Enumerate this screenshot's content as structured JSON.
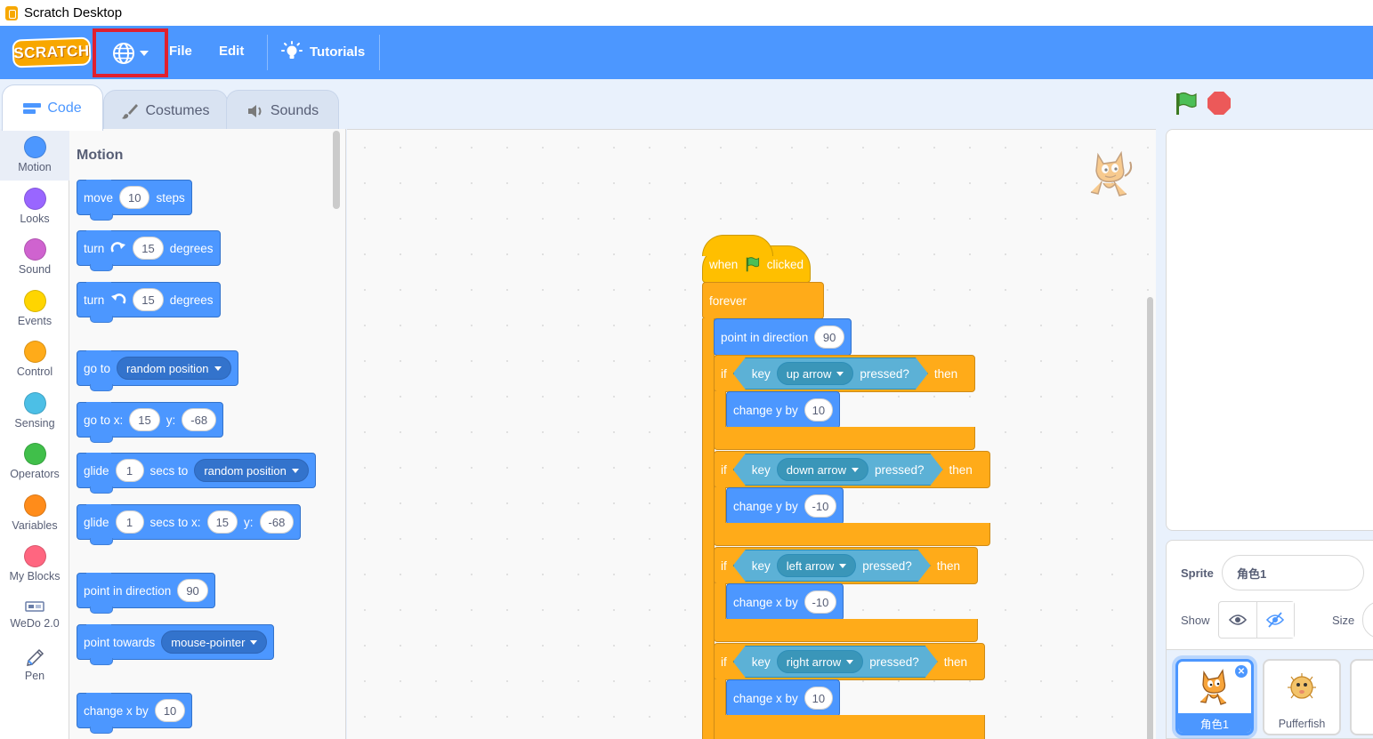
{
  "window": {
    "title": "Scratch Desktop"
  },
  "menubar": {
    "logo": "SCRATCH",
    "file": "File",
    "edit": "Edit",
    "tutorials": "Tutorials"
  },
  "tabs": [
    {
      "label": "Code",
      "icon": "code-icon"
    },
    {
      "label": "Costumes",
      "icon": "brush-icon"
    },
    {
      "label": "Sounds",
      "icon": "speaker-icon"
    }
  ],
  "categories": [
    {
      "label": "Motion",
      "color": "#4c97ff"
    },
    {
      "label": "Looks",
      "color": "#9966ff"
    },
    {
      "label": "Sound",
      "color": "#cf63cf"
    },
    {
      "label": "Events",
      "color": "#ffd500"
    },
    {
      "label": "Control",
      "color": "#ffab19"
    },
    {
      "label": "Sensing",
      "color": "#4cbfe6"
    },
    {
      "label": "Operators",
      "color": "#40bf4a"
    },
    {
      "label": "Variables",
      "color": "#ff8c1a"
    },
    {
      "label": "My Blocks",
      "color": "#ff6680"
    },
    {
      "label": "WeDo 2.0",
      "color": ""
    },
    {
      "label": "Pen",
      "color": ""
    }
  ],
  "palette": {
    "title": "Motion",
    "move": {
      "a": "move",
      "n": "10",
      "b": "steps"
    },
    "turn_right": {
      "a": "turn",
      "n": "15",
      "b": "degrees"
    },
    "turn_left": {
      "a": "turn",
      "n": "15",
      "b": "degrees"
    },
    "goto": {
      "a": "go to",
      "d": "random position"
    },
    "gotoxy": {
      "a": "go to x:",
      "x": "15",
      "b": "y:",
      "y": "-68"
    },
    "glide": {
      "a": "glide",
      "n": "1",
      "b": "secs to",
      "d": "random position"
    },
    "glidexy": {
      "a": "glide",
      "n": "1",
      "b": "secs to x:",
      "x": "15",
      "c": "y:",
      "y": "-68"
    },
    "point": {
      "a": "point in direction",
      "n": "90"
    },
    "towards": {
      "a": "point towards",
      "d": "mouse-pointer"
    },
    "changex": {
      "a": "change x by",
      "n": "10"
    }
  },
  "script": {
    "hat": {
      "a": "when",
      "b": "clicked"
    },
    "forever": "forever",
    "point": {
      "a": "point in direction",
      "n": "90"
    },
    "ifs": [
      {
        "if": "if",
        "key": "key",
        "opt": "up arrow",
        "pressed": "pressed?",
        "then": "then",
        "change": "change y by",
        "n": "10"
      },
      {
        "if": "if",
        "key": "key",
        "opt": "down arrow",
        "pressed": "pressed?",
        "then": "then",
        "change": "change y by",
        "n": "-10"
      },
      {
        "if": "if",
        "key": "key",
        "opt": "left arrow",
        "pressed": "pressed?",
        "then": "then",
        "change": "change x by",
        "n": "-10"
      },
      {
        "if": "if",
        "key": "key",
        "opt": "right arrow",
        "pressed": "pressed?",
        "then": "then",
        "change": "change x by",
        "n": "10"
      }
    ]
  },
  "sprite_info": {
    "sprite_label": "Sprite",
    "sprite_name": "角色1",
    "show_label": "Show",
    "size_label": "Size"
  },
  "sprites": [
    {
      "name": "角色1",
      "selected": true
    },
    {
      "name": "Pufferfish",
      "selected": false
    }
  ]
}
